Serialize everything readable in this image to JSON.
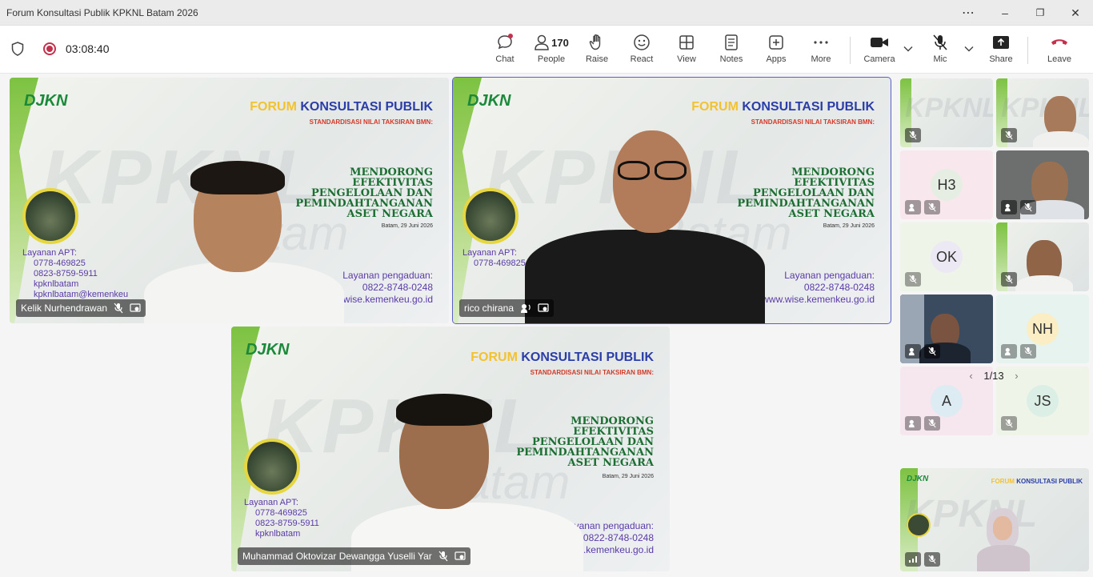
{
  "window": {
    "title": "Forum Konsultasi Publik KPKNL Batam 2026",
    "min": "–",
    "max": "❐",
    "close": "✕",
    "more": "⋯"
  },
  "meeting": {
    "timer": "03:08:40",
    "people_count": "170"
  },
  "toolbar": {
    "chat": "Chat",
    "people": "People",
    "raise": "Raise",
    "react": "React",
    "view": "View",
    "notes": "Notes",
    "apps": "Apps",
    "more": "More",
    "camera": "Camera",
    "mic": "Mic",
    "share": "Share",
    "leave": "Leave"
  },
  "slide": {
    "logo": "DJKN",
    "forum_a": "FORUM",
    "forum_b": "KONSULTASI PUBLIK",
    "standard": "STANDARDISASI NILAI TAKSIRAN BMN:",
    "h1": "MENDORONG",
    "h2": "EFEKTIVITAS",
    "h3": "PENGELOLAAN DAN",
    "h4": "PEMINDAHTANGANAN",
    "h5": "ASET NEGARA",
    "date": "Batam, 29 Juni 2026",
    "watermark": "KPKNL",
    "watermark2": "Batam",
    "apt_title": "Layanan APT:",
    "apt_phone1": "0778-469825",
    "apt_phone2": "0823-8759-5911",
    "apt_ig": "kpknlbatam",
    "apt_mail": "kpknlbatam@kemenkeu",
    "peng_title": "Layanan pengaduan:",
    "peng_phone": "0822-8748-0248",
    "peng_web": "www.wise.kemenkeu.go.id"
  },
  "participants": {
    "p1": "Kelik Nurhendrawan",
    "p2": "rico chirana",
    "p3": "Muhammad Oktovizar Dewangga Yuselli Yar"
  },
  "gallery": {
    "h3": "H3",
    "ok": "OK",
    "nh": "NH",
    "a": "A",
    "js": "JS"
  },
  "pager": {
    "prev": "‹",
    "label": "1/13",
    "next": "›"
  },
  "colors": {
    "accent": "#5b5fc7",
    "leave": "#c4314b",
    "record": "#c4314b"
  }
}
